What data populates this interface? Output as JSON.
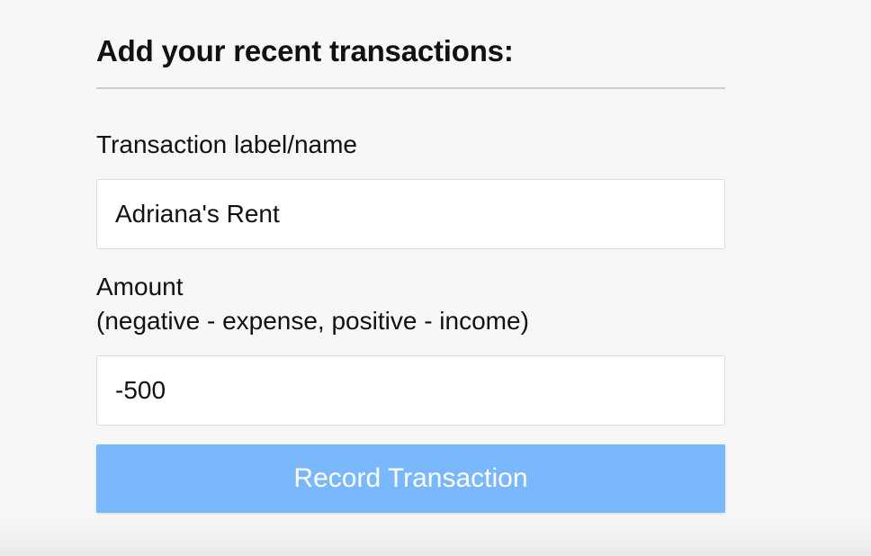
{
  "form": {
    "title": "Add your recent transactions:",
    "name_label": "Transaction label/name",
    "name_value": "Adriana's Rent",
    "amount_label": "Amount",
    "amount_hint": "(negative - expense, positive - income)",
    "amount_value": "-500",
    "submit_label": "Record Transaction"
  },
  "colors": {
    "background": "#f7f7f7",
    "button": "#7ab8fd",
    "button_text": "#ffffff"
  }
}
